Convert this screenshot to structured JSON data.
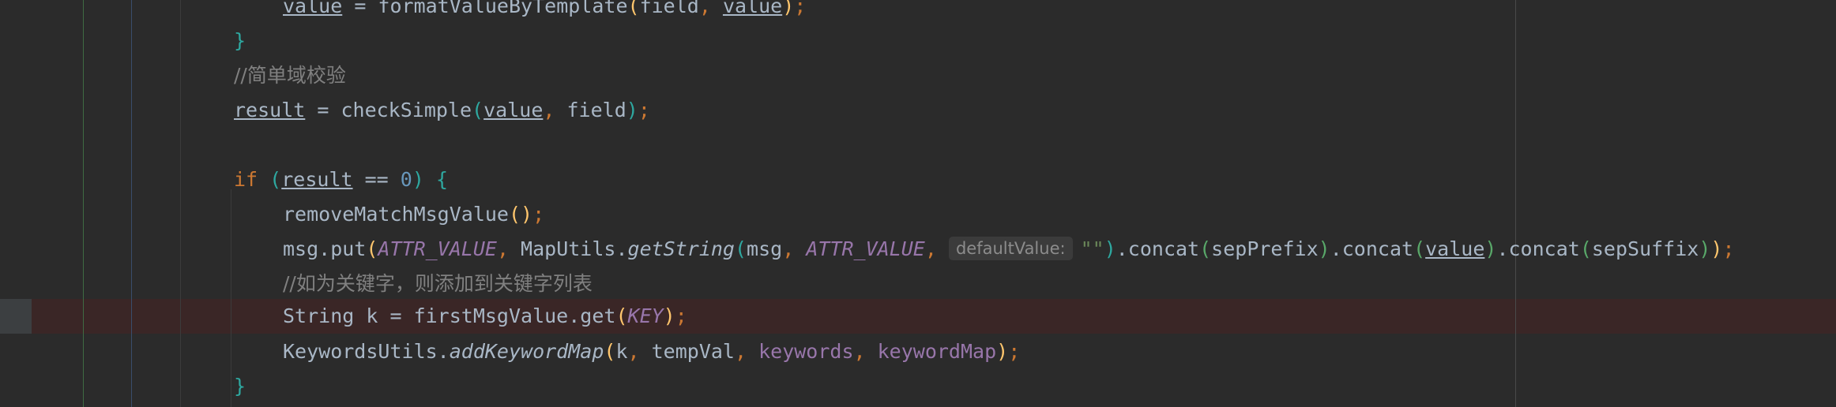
{
  "editor": {
    "lines": {
      "l0": {
        "var1": "value",
        "eq": " = ",
        "fn": "formatValueByTemplate",
        "open": "(",
        "arg1": "field",
        "comma": ", ",
        "arg2": "value",
        "close": ")",
        "semi": ";"
      },
      "l1": {
        "brace": "}"
      },
      "l2": {
        "comment": "//简单域校验"
      },
      "l3": {
        "var": "result",
        "eq": " = ",
        "fn": "checkSimple",
        "open": "(",
        "arg1": "value",
        "comma": ", ",
        "arg2": "field",
        "close": ")",
        "semi": ";"
      },
      "l5": {
        "kw": "if",
        "sp": " ",
        "open": "(",
        "var": "result",
        "op": " == ",
        "num": "0",
        "close": ")",
        "brace": " {"
      },
      "l6": {
        "fn": "removeMatchMsgValue",
        "parens": "()",
        "semi": ";"
      },
      "l7": {
        "obj": "msg.put",
        "open": "(",
        "c1": "ATTR_VALUE",
        "comma1": ", ",
        "cls": "MapUtils.",
        "m": "getString",
        "open2": "(",
        "a1": "msg",
        "comma2": ", ",
        "c2": "ATTR_VALUE",
        "comma3": ", ",
        "hint": "defaultValue:",
        "str": "\"\"",
        "close2": ")",
        "concat1": ".concat",
        "open3": "(",
        "a2": "sepPrefix",
        "close3": ")",
        "concat2": ".concat",
        "open4": "(",
        "a3": "value",
        "close4": ")",
        "concat3": ".concat",
        "open5": "(",
        "a4": "sepSuffix",
        "close5": ")",
        "close1": ")",
        "semi": ";"
      },
      "l8": {
        "comment": "//如为关键字，则添加到关键字列表"
      },
      "l9": {
        "type": "String",
        "rest": " k = firstMsgValue.get",
        "open": "(",
        "c": "KEY",
        "close": ")",
        "semi": ";"
      },
      "l10": {
        "cls": "KeywordsUtils.",
        "m": "addKeywordMap",
        "open": "(",
        "a1": "k",
        "comma1": ", ",
        "a2": "tempVal",
        "comma2": ", ",
        "f1": "keywords",
        "comma3": ", ",
        "f2": "keywordMap",
        "close": ")",
        "semi": ";"
      },
      "l11": {
        "brace": "}"
      }
    }
  }
}
